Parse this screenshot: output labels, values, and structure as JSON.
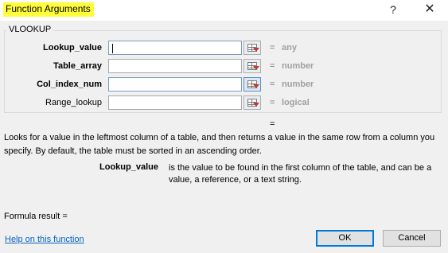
{
  "window": {
    "title": "Function Arguments",
    "help_glyph": "?",
    "close_glyph": "✕"
  },
  "function_name": "VLOOKUP",
  "arguments": [
    {
      "label": "Lookup_value",
      "value": "",
      "result": "any"
    },
    {
      "label": "Table_array",
      "value": "",
      "result": "number"
    },
    {
      "label": "Col_index_num",
      "value": "",
      "result": "number"
    },
    {
      "label": "Range_lookup",
      "value": "",
      "result": "logical"
    }
  ],
  "equals": "=",
  "description": "Looks for a value in the leftmost column of a table, and then returns a value in the same row from a column you specify. By default, the table must be sorted in an ascending order.",
  "arg_help": {
    "name": "Lookup_value",
    "text": "is the value to be found in the first column of the table, and can be a value, a reference, or a text string."
  },
  "formula_result_label": "Formula result =",
  "help_link": "Help on this function",
  "buttons": {
    "ok": "OK",
    "cancel": "Cancel"
  },
  "icons": {
    "collapse": "collapse-dialog-icon"
  },
  "colors": {
    "title_highlight": "#ffff3c",
    "link": "#0563c1",
    "default_button_border": "#0078d7"
  }
}
